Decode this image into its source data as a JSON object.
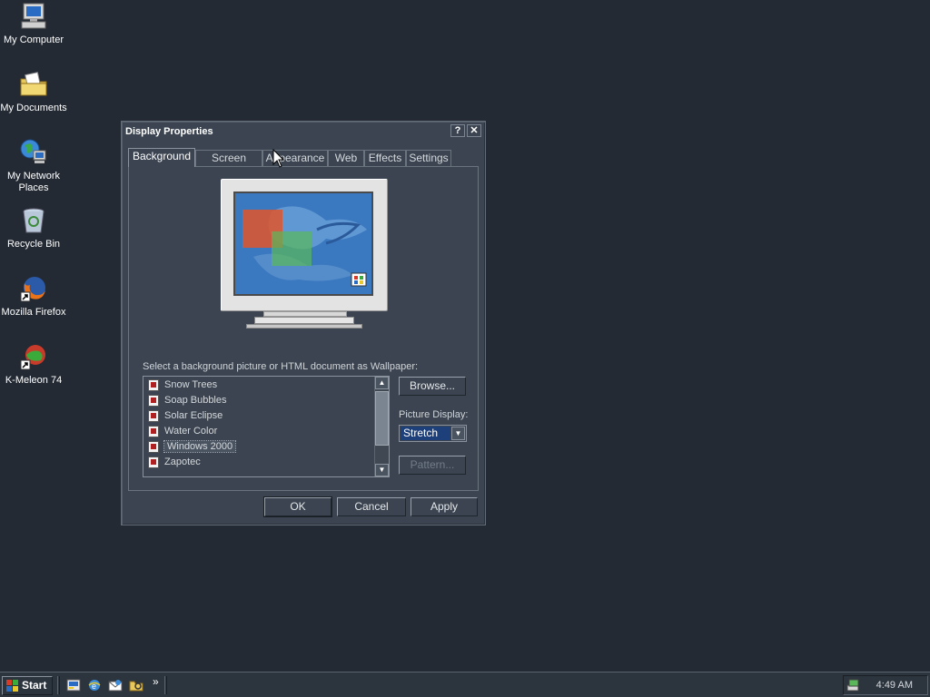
{
  "desktop": {
    "icons": [
      {
        "label": "My Computer",
        "icon": "my-computer-icon"
      },
      {
        "label": "My Documents",
        "icon": "my-documents-icon"
      },
      {
        "label": "My Network Places",
        "icon": "network-places-icon"
      },
      {
        "label": "Recycle Bin",
        "icon": "recycle-bin-icon"
      },
      {
        "label": "Mozilla Firefox",
        "icon": "firefox-icon"
      },
      {
        "label": "K-Meleon 74",
        "icon": "k-meleon-icon"
      }
    ]
  },
  "dialog": {
    "title": "Display Properties",
    "help_glyph": "?",
    "close_glyph": "✕",
    "tabs": [
      {
        "label": "Background",
        "active": true
      },
      {
        "label": "Screen Saver",
        "active": false
      },
      {
        "label": "Appearance",
        "active": false
      },
      {
        "label": "Web",
        "active": false
      },
      {
        "label": "Effects",
        "active": false
      },
      {
        "label": "Settings",
        "active": false
      }
    ],
    "instruction": "Select a background picture or HTML document as Wallpaper:",
    "wallpapers": [
      {
        "label": "Snow Trees"
      },
      {
        "label": "Soap Bubbles"
      },
      {
        "label": "Solar Eclipse"
      },
      {
        "label": "Water Color"
      },
      {
        "label": "Windows 2000",
        "selected": true
      },
      {
        "label": "Zapotec"
      }
    ],
    "browse_label": "Browse...",
    "picture_display_label": "Picture Display:",
    "picture_display_value": "Stretch",
    "pattern_label": "Pattern...",
    "ok_label": "OK",
    "cancel_label": "Cancel",
    "apply_label": "Apply"
  },
  "taskbar": {
    "start_label": "Start",
    "chevron": "»",
    "quick_launch": [
      "show-desktop-icon",
      "internet-explorer-icon",
      "outlook-express-icon",
      "explorer-icon"
    ],
    "clock": "4:49 AM"
  },
  "colors": {
    "desktop": "#232a33",
    "dialog": "#3b4450",
    "selection": "#1d3f7a",
    "wallpaper_preview": "#3a78c0"
  }
}
